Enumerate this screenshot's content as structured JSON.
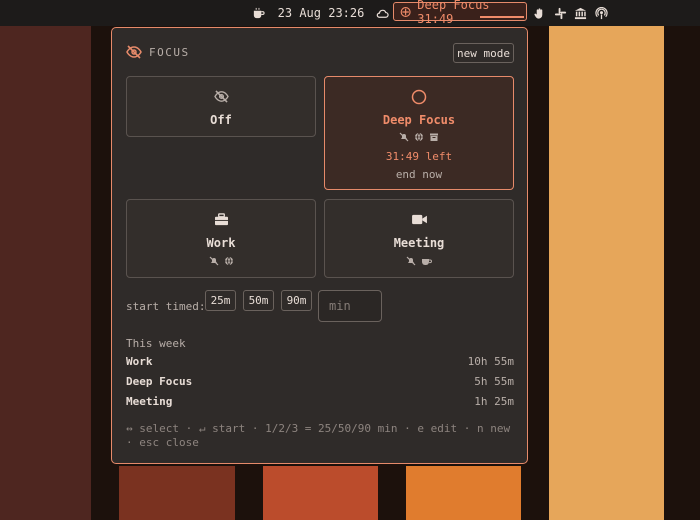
{
  "menubar": {
    "clock": "23 Aug 23:26",
    "focus_status": "Deep Focus 31:49",
    "icons": [
      "coffee-icon",
      "cloud-icon",
      "focus-target-icon",
      "hand-icon",
      "slack-icon",
      "bank-icon",
      "podcast-icon"
    ]
  },
  "popover": {
    "title": "FOCUS",
    "new_mode_label": "new mode",
    "modes": [
      {
        "label": "Off",
        "icon": "eye-off-icon"
      },
      {
        "label": "Deep Focus",
        "icon": "circle-icon",
        "time_left": "31:49 left",
        "end_label": "end now",
        "sub_icons": [
          "bell-off-icon",
          "globe-icon",
          "archive-icon"
        ]
      },
      {
        "label": "Work",
        "icon": "briefcase-icon",
        "sub_icons": [
          "bell-off-icon",
          "globe-icon"
        ]
      },
      {
        "label": "Meeting",
        "icon": "video-icon",
        "sub_icons": [
          "bell-off-icon",
          "coffee-icon"
        ]
      }
    ],
    "start_timed_label": "start timed:",
    "timed_options": [
      "25m",
      "50m",
      "90m"
    ],
    "min_placeholder": "min",
    "week": {
      "title": "This week",
      "rows": [
        {
          "name": "Work",
          "duration": "10h 55m"
        },
        {
          "name": "Deep Focus",
          "duration": "5h 55m"
        },
        {
          "name": "Meeting",
          "duration": "1h 25m"
        }
      ]
    },
    "footer_hint": "↔ select · ↵ start · 1/2/3 = 25/50/90 min · e edit · n new · esc close"
  },
  "colors": {
    "accent": "#e68a6a",
    "panel": "#2f2b29"
  }
}
